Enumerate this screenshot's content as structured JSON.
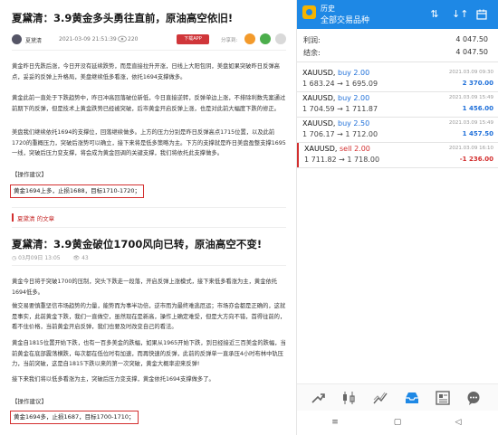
{
  "article1": {
    "title": "夏黛清：3.9黄金多头勇往直前，原油高空依旧!",
    "author": "夏黛清",
    "time": "2021-03-09 21:51:39",
    "views": "220",
    "app_button": "下载APP",
    "share_label": "分享到:",
    "paragraphs": [
      "黄金昨日先跌后涨，今日开没有延续跌势，而是直接拉升开涨，日线上大阳包阴，美盘如果突破昨日反弹高点，妥妥的反弹上升格局，美盘继续低多看涨，依托1694支撑做多。",
      "黄金此前一直处于下跌趋势中，昨日冲高回落破位新低，今日直接逆转，反弹单边上涨，不排除利数先案通过前期下的反弹，但是技术上黄金跌势已经被突破，后市黄金开启反弹上涨，也是对此前大幅度下跌的修正。",
      "美盘我们继续依托1694的支撑位，回落继续做多。上方的压力分别是昨日反弹高点1715位置，以及此前1720的重概压力，突破后涨势可以确立，接下来将是低多策略为主。下方的支撑就是昨日美盘盈整支撑1695一线，突破后压力变支撑，将会成为黄金回调的关键支撑，我们将依托此支撑做多。"
    ],
    "ops_label": "【操作建议】",
    "ops": "黄金1694上多，止损1688，目标1710-1720；"
  },
  "related_label": "夏黛清 的文章",
  "article2": {
    "title": "夏黛清：3.9黄金破位1700风向已转，原油高空不变!",
    "date": "03月09日 13:05",
    "views": "43",
    "paragraphs": [
      "黄金今日将于突破1700的压制，突头下跌走一段落，开启反弹上涨模式，接下来低多看涨为主，黄金依托1694低多。",
      "做交易要慎重坚信市场趋势的力量，能势而为事半功倍，逆市而为最终难逃厄运；市场亦会都是正确的，这就是事实，此前黄金下跌，我们一直做空，虽然现在是新高，操作上确定难受，但是大方向不错，首得往前的，看不住价格，当前黄金开启反弹，我们也要及时改变自己的看法。",
      "黄金自1815位置开始下跌，也有一百多美金的跌幅，如果从1965开始下跌，到日经接近三百美金的跌幅，当前黄金在底部震荡横跌，每次都在低位时有加速，而再快速的反弹，此前的反弹单一直承压4小时布林中轨压力，当前突破，这是自1815下跌以来的第一次突破，黄金大概率迎来反弹!",
      "接下来我们将以低多看涨为主，突破后压力变支撑，黄金依托1694支撑做多了。"
    ],
    "ops_label": "【操作建议】",
    "ops": "黄金1694多，止损1687，目标1700-1710；"
  },
  "app": {
    "title": "历史",
    "subtitle": "全部交易品种",
    "header_icons": [
      "swap-icon",
      "sort-icon",
      "calendar-icon"
    ],
    "profit_label": "利润:",
    "profit_value": "4 047.50",
    "balance_label": "结余:",
    "balance_value": "4 047.50",
    "trades": [
      {
        "symbol": "XAUUSD,",
        "direction": "buy 2.00",
        "prices": "1 683.24 → 1 695.09",
        "date": "2021.03.09 09:30",
        "pl": "2 370.00",
        "type": "buy"
      },
      {
        "symbol": "XAUUSD,",
        "direction": "buy 2.00",
        "prices": "1 704.59 → 1 711.87",
        "date": "2021.03.09 15:49",
        "pl": "1 456.00",
        "type": "buy"
      },
      {
        "symbol": "XAUUSD,",
        "direction": "buy 2.50",
        "prices": "1 706.17 → 1 712.00",
        "date": "2021.03.09 15:49",
        "pl": "1 457.50",
        "type": "buy"
      },
      {
        "symbol": "XAUUSD,",
        "direction": "sell 2.00",
        "prices": "1 711.82 → 1 718.00",
        "date": "2021.03.09 16:10",
        "pl": "-1 236.00",
        "type": "sell"
      }
    ],
    "nav": [
      "quotes-icon",
      "chart-icon",
      "trade-icon",
      "history-icon",
      "news-icon",
      "chat-icon"
    ],
    "accent": "#1e88e5",
    "buy_color": "#1e6fd9",
    "sell_color": "#d32f2f"
  }
}
